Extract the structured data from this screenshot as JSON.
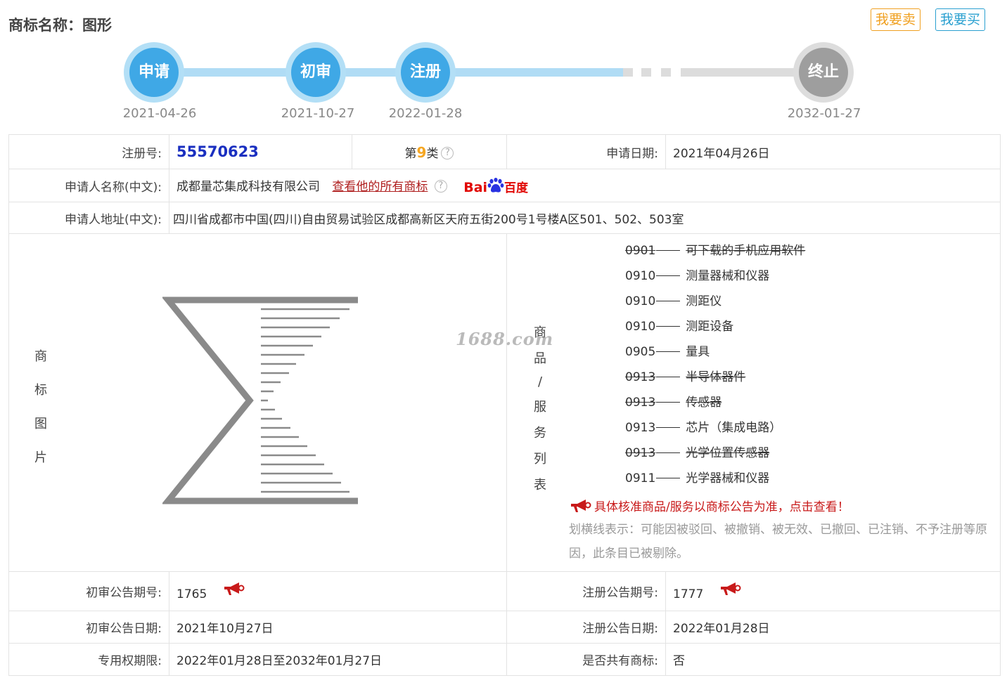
{
  "header": {
    "title": "商标名称：图形",
    "sell_label": "我要卖",
    "buy_label": "我要买"
  },
  "timeline": {
    "steps": [
      {
        "label": "申请",
        "date": "2021-04-26"
      },
      {
        "label": "初审",
        "date": "2021-10-27"
      },
      {
        "label": "注册",
        "date": "2022-01-28"
      },
      {
        "label": "终止",
        "date": "2032-01-27"
      }
    ]
  },
  "info": {
    "reg_no_label": "注册号:",
    "reg_no": "55570623",
    "class_prefix": "第",
    "class_num": "9",
    "class_suffix": "类",
    "apply_date_label": "申请日期:",
    "apply_date": "2021年04月26日",
    "applicant_label": "申请人名称(中文):",
    "applicant": "成都量芯集成科技有限公司",
    "view_all_link": "查看他的所有商标",
    "baidu_bai": "Bai",
    "baidu_du": "百度",
    "address_label": "申请人地址(中文):",
    "address": "四川省成都市中国(四川)自由贸易试验区成都高新区天府五街200号1号楼A区501、502、503室",
    "image_label_chars": [
      "商",
      "标",
      "图",
      "片"
    ],
    "goods_label_chars": [
      "商",
      "品",
      "/",
      "服",
      "务",
      "列",
      "表"
    ],
    "goods": [
      {
        "code": "0901",
        "name": "可下载的手机应用软件",
        "struck": true
      },
      {
        "code": "0910",
        "name": "测量器械和仪器",
        "struck": false
      },
      {
        "code": "0910",
        "name": "测距仪",
        "struck": false
      },
      {
        "code": "0910",
        "name": "测距设备",
        "struck": false
      },
      {
        "code": "0905",
        "name": "量具",
        "struck": false
      },
      {
        "code": "0913",
        "name": "半导体器件",
        "struck": true
      },
      {
        "code": "0913",
        "name": "传感器",
        "struck": true
      },
      {
        "code": "0913",
        "name": "芯片（集成电路）",
        "struck": false
      },
      {
        "code": "0913",
        "name": "光学位置传感器",
        "struck": true
      },
      {
        "code": "0911",
        "name": "光学器械和仪器",
        "struck": false
      }
    ],
    "goods_notice": "具体核准商品/服务以商标公告为准，点击查看！",
    "strike_note": "划横线表示：可能因被驳回、被撤销、被无效、已撤回、已注销、不予注册等原因，此条目已被剔除。",
    "watermark": "1688.com",
    "prelim_no_label": "初审公告期号:",
    "prelim_no": "1765",
    "reg_pub_no_label": "注册公告期号:",
    "reg_pub_no": "1777",
    "prelim_date_label": "初审公告日期:",
    "prelim_date": "2021年10月27日",
    "reg_pub_date_label": "注册公告日期:",
    "reg_pub_date": "2022年01月28日",
    "exclusive_label": "专用权期限:",
    "exclusive": "2022年01月28日至2032年01月27日",
    "shared_label": "是否共有商标:",
    "shared": "否"
  },
  "colors": {
    "timeline_active": "#3fa8e6",
    "timeline_end": "#9e9e9e",
    "reg_no": "#1a2fc0",
    "class_num": "#f5a623",
    "notice_red": "#c81a1a"
  }
}
